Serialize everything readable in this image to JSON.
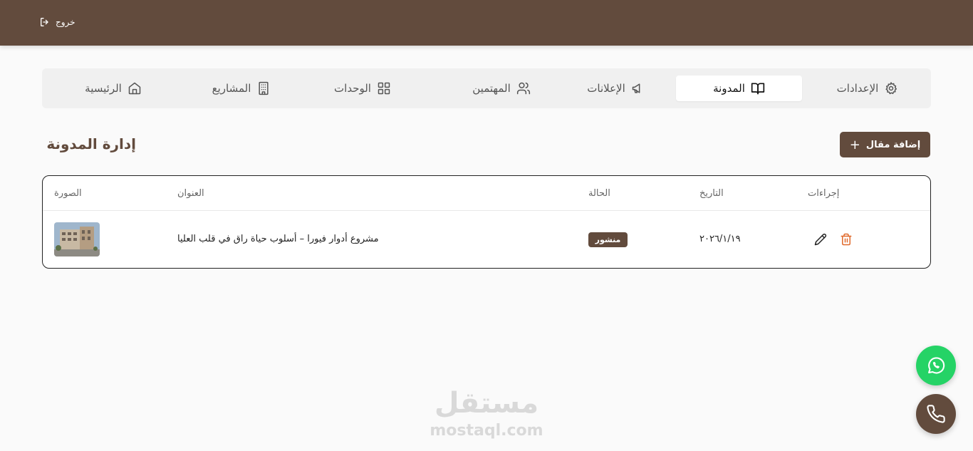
{
  "header": {
    "logout_label": "خروج",
    "logout_icon": "log-out-icon"
  },
  "tabs": [
    {
      "label": "الإعدادات",
      "icon": "settings-icon",
      "active": false
    },
    {
      "label": "المدونة",
      "icon": "book-open-icon",
      "active": true
    },
    {
      "label": "الإعلانات",
      "icon": "megaphone-icon",
      "active": false
    },
    {
      "label": "المهتمين",
      "icon": "users-icon",
      "active": false
    },
    {
      "label": "الوحدات",
      "icon": "grid-icon",
      "active": false
    },
    {
      "label": "المشاريع",
      "icon": "building-icon",
      "active": false
    },
    {
      "label": "الرئيسية",
      "icon": "home-icon",
      "active": false
    }
  ],
  "page": {
    "title": "إدارة المدونة",
    "add_button_label": "إضافة مقال"
  },
  "table": {
    "columns": {
      "image": "الصورة",
      "title": "العنوان",
      "status": "الحالة",
      "date": "التاريخ",
      "actions": "إجراءات"
    },
    "rows": [
      {
        "title": "مشروع أدوار فيورا – أسلوب حياة راق في قلب العليا",
        "status": "منشور",
        "date": "٢٠٢٦/١/١٩"
      }
    ]
  },
  "watermark": {
    "arabic": "مستقل",
    "latin": "mostaql.com"
  },
  "colors": {
    "brand": "#624b3d",
    "whatsapp": "#25d366",
    "delete": "#e0692a"
  }
}
